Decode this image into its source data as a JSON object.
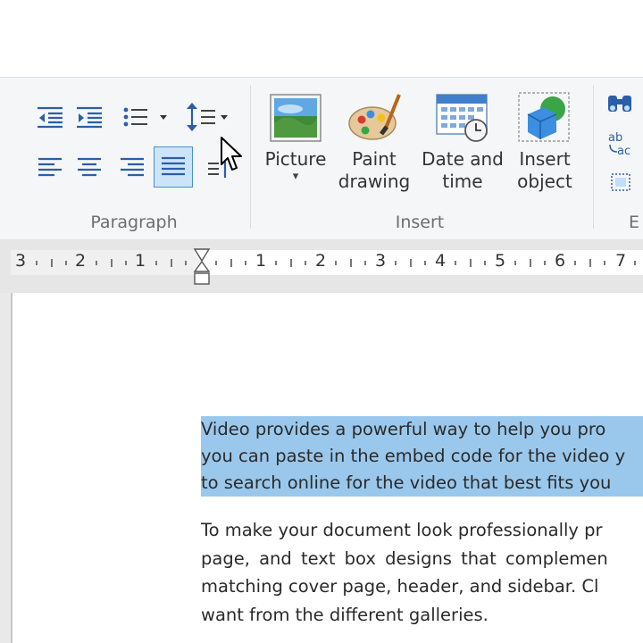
{
  "ribbon": {
    "groups": [
      {
        "label": "Paragraph"
      },
      {
        "label": "Insert"
      },
      {
        "label": "E"
      }
    ],
    "paragraph_buttons": [
      "decrease-indent",
      "increase-indent",
      "bullet-list",
      "line-spacing",
      "align-left",
      "align-center",
      "align-right",
      "justify",
      "paragraph-direction"
    ],
    "insert_buttons": [
      {
        "label": "Picture",
        "has_dropdown": true
      },
      {
        "label_line1": "Paint",
        "label_line2": "drawing"
      },
      {
        "label_line1": "Date and",
        "label_line2": "time"
      },
      {
        "label_line1": "Insert",
        "label_line2": "object"
      }
    ],
    "selected_button": "justify"
  },
  "ruler": {
    "left_numbers": [
      "3",
      "2",
      "1"
    ],
    "right_numbers": [
      "1",
      "2",
      "3",
      "4",
      "5",
      "6",
      "7"
    ]
  },
  "document": {
    "selected_paragraph": [
      "Video provides a powerful way to help you pro",
      "you can paste in the embed code for the video y",
      "to search online for the video that best fits you"
    ],
    "paragraph2": [
      "To make your document look professionally pr",
      "page, and text box designs that complemen",
      "matching cover page, header, and sidebar. Cl",
      "want from the different galleries."
    ]
  },
  "colors": {
    "ribbon_bg": "#f5f6f7",
    "selection": "#9ac8ec",
    "selected_button_bg": "#cce4f7",
    "selected_button_border": "#4a90d1"
  }
}
